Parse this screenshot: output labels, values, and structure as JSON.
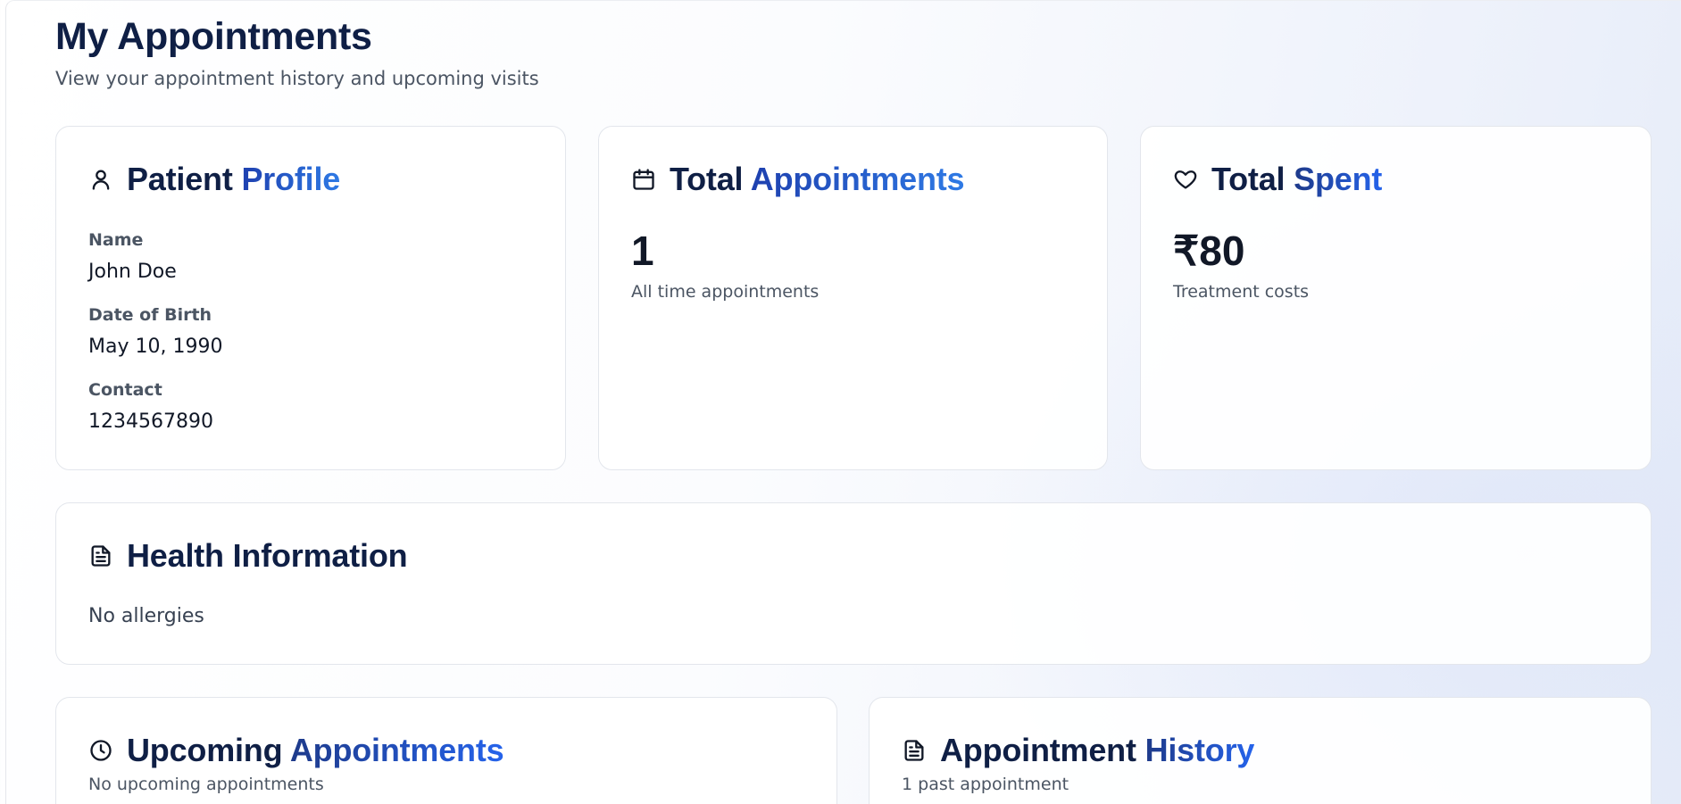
{
  "header": {
    "title": "My Appointments",
    "subtitle": "View your appointment history and upcoming visits"
  },
  "patient_profile": {
    "icon": "user-icon",
    "title_main": "Patient",
    "title_accent": "Profile",
    "fields": [
      {
        "label": "Name",
        "value": "John Doe"
      },
      {
        "label": "Date of Birth",
        "value": "May 10, 1990"
      },
      {
        "label": "Contact",
        "value": "1234567890"
      }
    ]
  },
  "total_appointments": {
    "icon": "calendar-icon",
    "title_main": "Total",
    "title_accent": "Appointments",
    "value": "1",
    "caption": "All time appointments"
  },
  "total_spent": {
    "icon": "heart-icon",
    "title_main": "Total",
    "title_accent": "Spent",
    "value": "₹80",
    "caption": "Treatment costs"
  },
  "health_information": {
    "icon": "document-icon",
    "title": "Health Information",
    "text": "No allergies"
  },
  "upcoming_appointments": {
    "icon": "clock-icon",
    "title_main": "Upcoming",
    "title_accent": "Appointments",
    "subtitle": "No upcoming appointments"
  },
  "appointment_history": {
    "icon": "document-icon",
    "title_main": "Appointment",
    "title_accent": "History",
    "subtitle": "1 past appointment"
  },
  "colors": {
    "heading": "#0f1f45",
    "accent_start": "#1e40af",
    "accent_end": "#2f7ae5",
    "muted_text": "#4b5563",
    "card_border": "#e3e6ec"
  }
}
